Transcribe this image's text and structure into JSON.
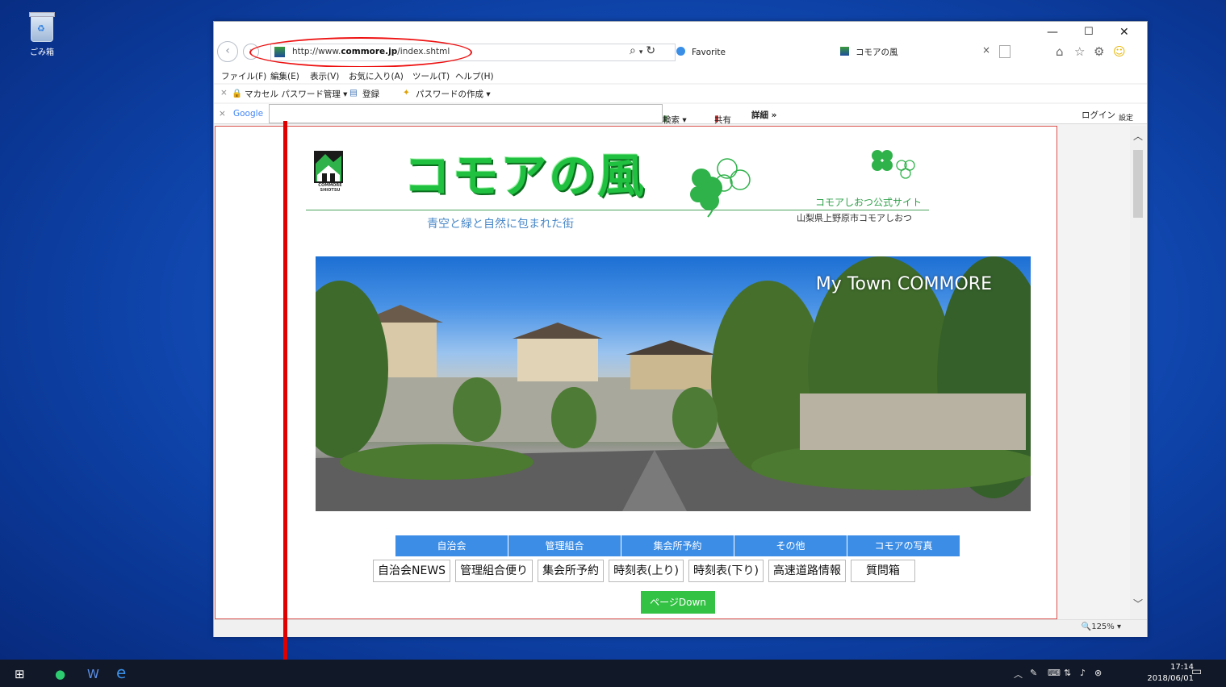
{
  "desktop": {
    "recycle_bin_label": "ごみ箱"
  },
  "browser": {
    "address": {
      "url_prefix": "http://www.",
      "url_domain": "commore.jp",
      "url_path": "/index.shtml"
    },
    "tabs": [
      {
        "label": "Favorite"
      },
      {
        "label": "コモアの風"
      }
    ],
    "menu": [
      "ファイル(F)",
      "編集(E)",
      "表示(V)",
      "お気に入り(A)",
      "ツール(T)",
      "ヘルプ(H)"
    ],
    "toolbar1": {
      "macafee": "マカセル パスワード管理 ▾",
      "register": "登録",
      "create_pw": "パスワードの作成 ▾"
    },
    "toolbar2": {
      "google": "Google",
      "search": "検索 ▾",
      "share": "共有",
      "details": "詳細 »",
      "login": "ログイン",
      "settings": "設定"
    },
    "zoom": "125%"
  },
  "page": {
    "logo_mark_text": "COMMORE SHIOTSU",
    "title": "コモアの風",
    "tagline": "青空と緑と自然に包まれた街",
    "site_name": "コモアしおつ公式サイト",
    "site_address": "山梨県上野原市コモアしおつ",
    "hero_caption": "My Town COMMORE",
    "nav_primary": [
      "自治会",
      "管理組合",
      "集会所予約",
      "その他",
      "コモアの写真"
    ],
    "nav_secondary": [
      "自治会NEWS",
      "管理組合便り",
      "集会所予約",
      "時刻表(上り)",
      "時刻表(下り)",
      "高速道路情報",
      "質問箱"
    ],
    "page_down": "ページDown"
  },
  "taskbar": {
    "time": "17:14",
    "date": "2018/06/01"
  },
  "colors": {
    "accent_blue": "#3b8de6",
    "accent_green": "#33c244",
    "annotation_red": "#e10000"
  }
}
